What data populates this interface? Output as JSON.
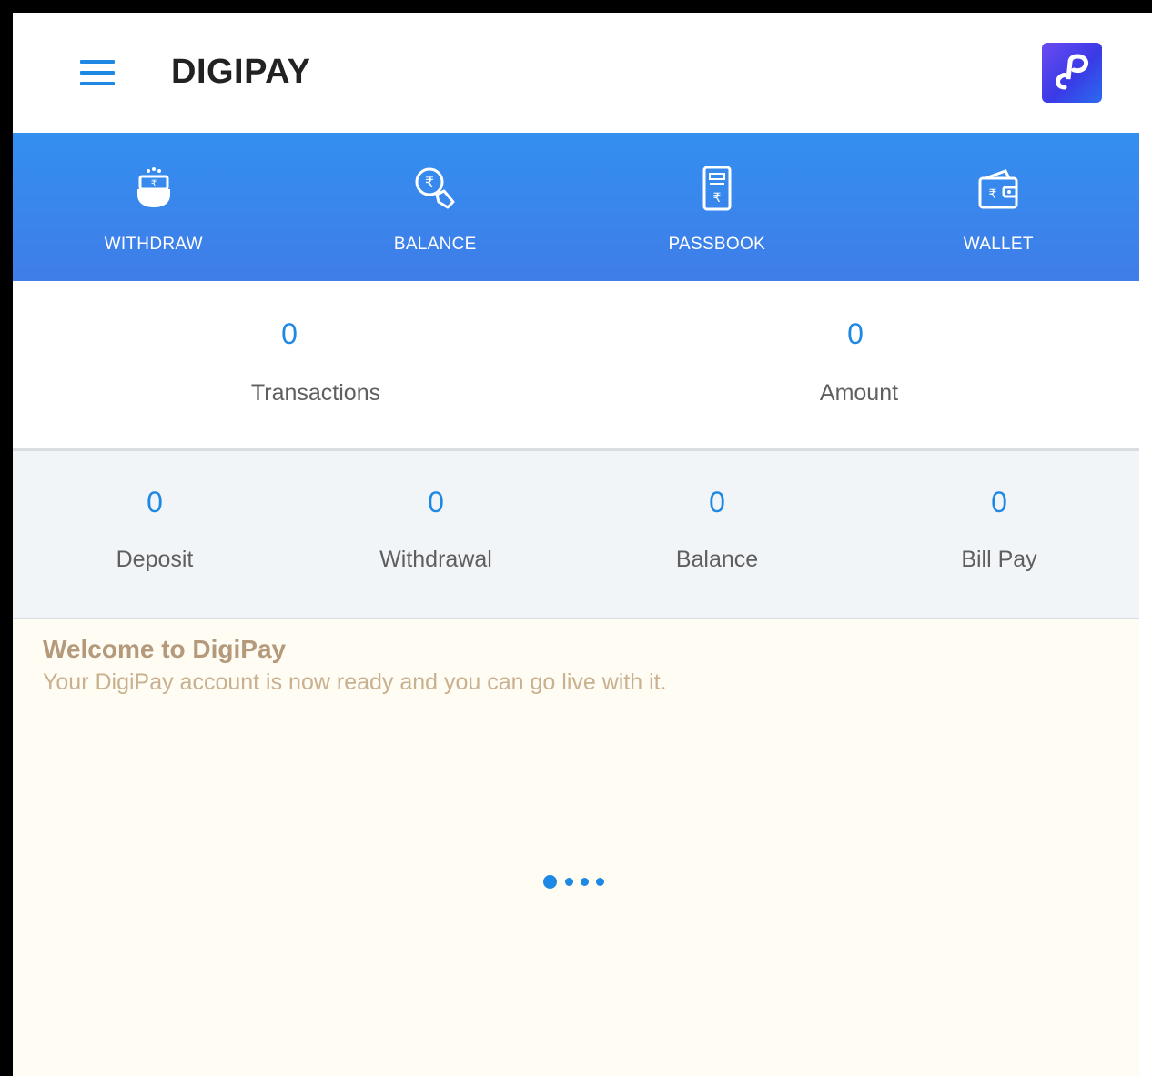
{
  "header": {
    "title": "DIGIPAY",
    "menu_icon": "hamburger-menu-icon",
    "logo_icon": "digipay-logo-icon"
  },
  "actions": [
    {
      "label": "WITHDRAW",
      "icon": "cash-withdraw-icon"
    },
    {
      "label": "BALANCE",
      "icon": "rupee-balance-icon"
    },
    {
      "label": "PASSBOOK",
      "icon": "passbook-icon"
    },
    {
      "label": "WALLET",
      "icon": "wallet-icon"
    }
  ],
  "summary": [
    {
      "value": "0",
      "label": "Transactions"
    },
    {
      "value": "0",
      "label": "Amount"
    }
  ],
  "breakdown": [
    {
      "value": "0",
      "label": "Deposit"
    },
    {
      "value": "0",
      "label": "Withdrawal"
    },
    {
      "value": "0",
      "label": "Balance"
    },
    {
      "value": "0",
      "label": "Bill Pay"
    }
  ],
  "welcome": {
    "title": "Welcome to DigiPay",
    "text": "Your DigiPay account is now ready and you can go live with it."
  },
  "colors": {
    "accent": "#1e88e5",
    "action_bar": "#3a86ee",
    "welcome_bg": "#fffcf4",
    "welcome_title": "#b49a7a"
  }
}
